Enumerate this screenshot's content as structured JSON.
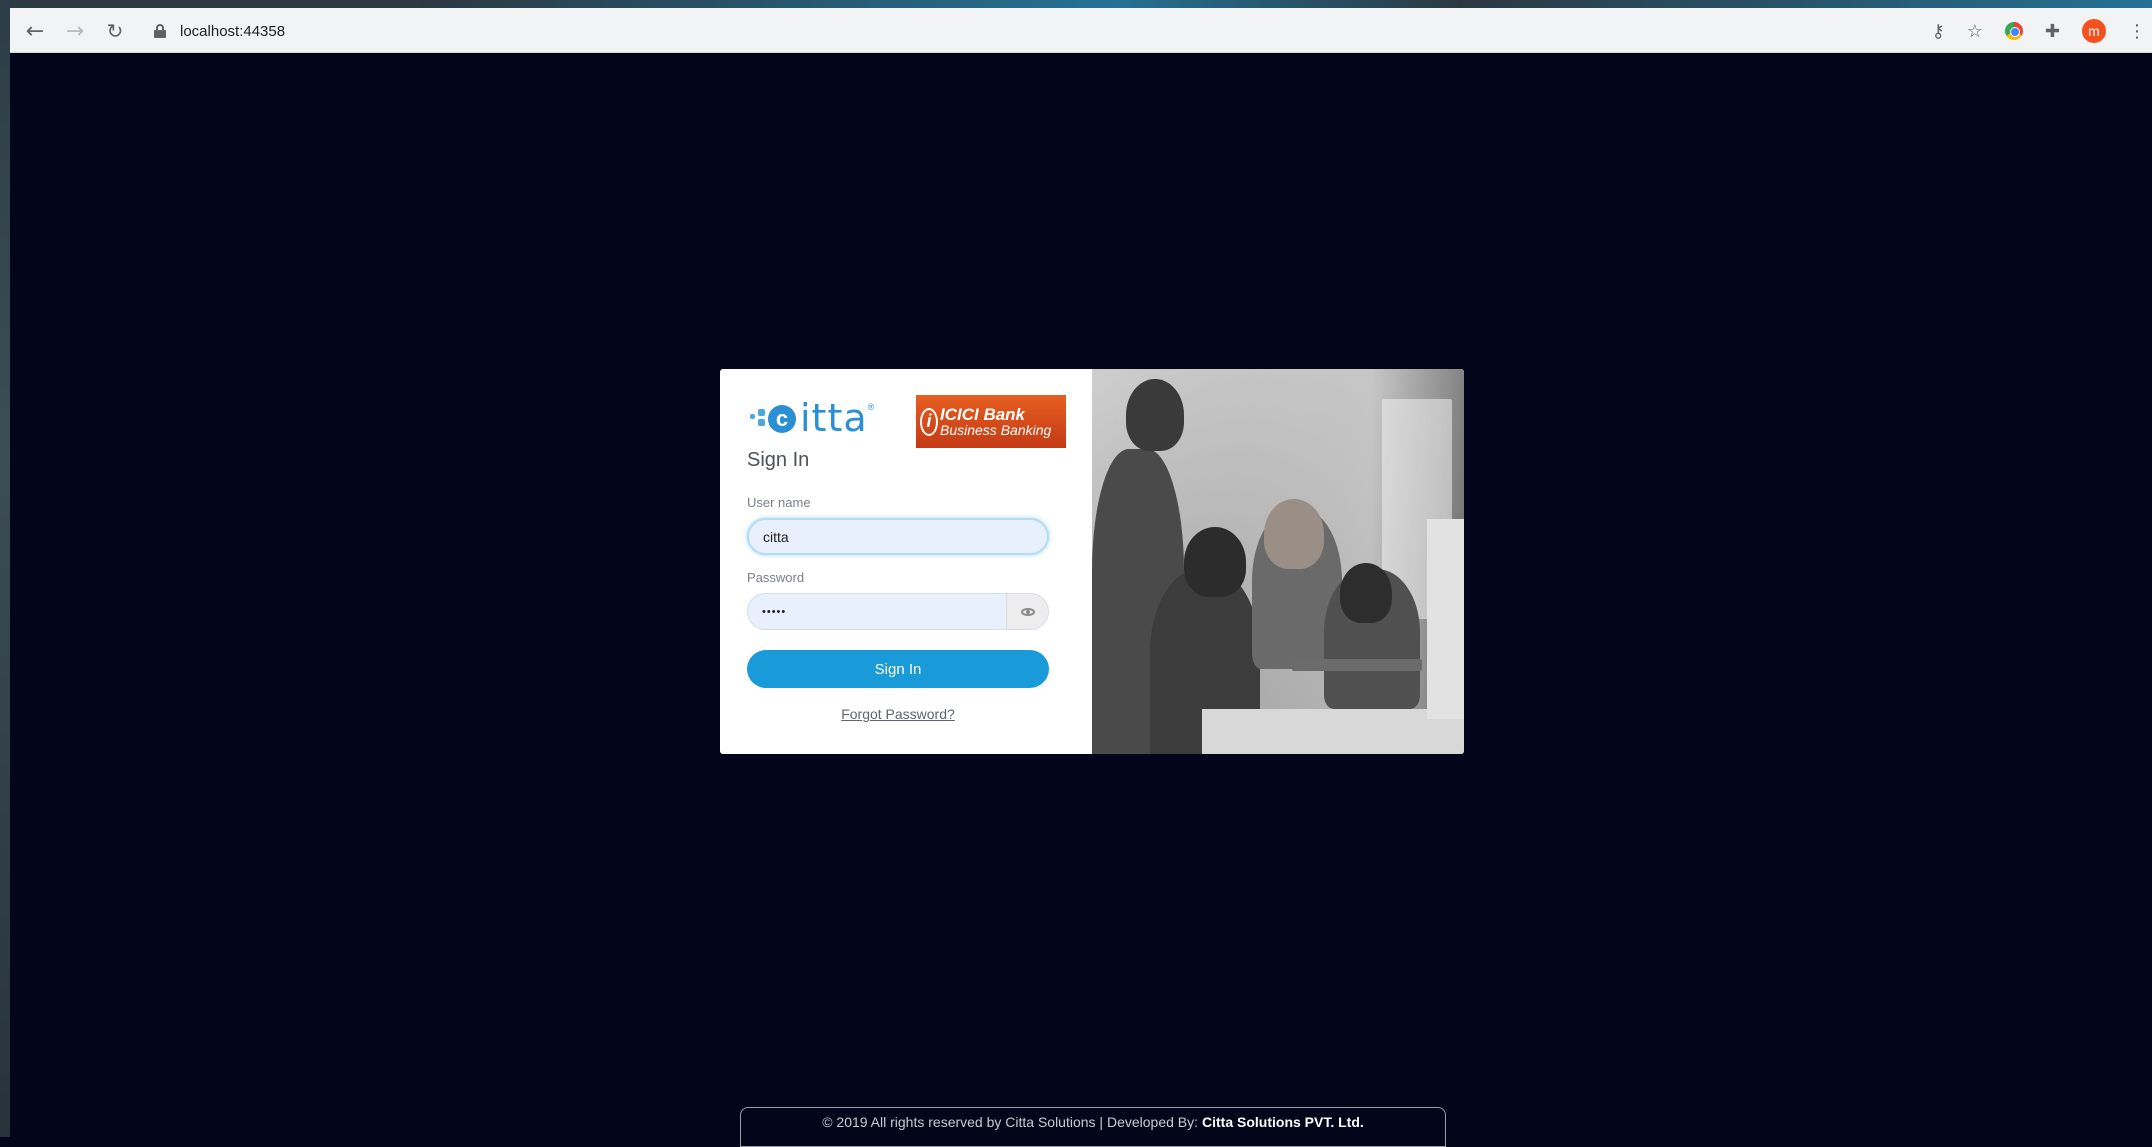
{
  "browser": {
    "url": "localhost:44358",
    "avatar_letter": "m"
  },
  "login": {
    "brand_word": "itta",
    "brand_reg": "®",
    "bank_name": "ICICI Bank",
    "bank_sub": "Business Banking",
    "title": "Sign In",
    "username_label": "User name",
    "username_value": "citta",
    "password_label": "Password",
    "password_value": "•••••",
    "signin_label": "Sign In",
    "forgot_label": "Forgot Password?"
  },
  "footer": {
    "text": "© 2019 All rights reserved by Citta Solutions | Developed By:",
    "company": "Citta Solutions PVT. Ltd."
  },
  "colors": {
    "background": "#03051a",
    "accent": "#199ad9",
    "bank": "#e65f20"
  }
}
